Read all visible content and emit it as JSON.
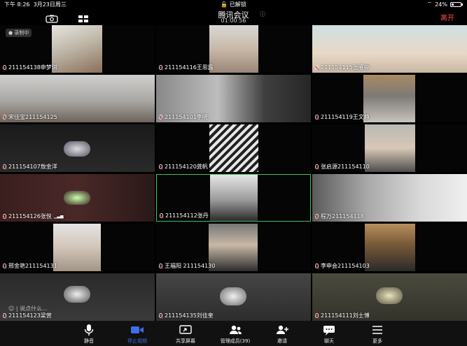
{
  "status": {
    "time": "下午 8:26",
    "date": "3月23日周三",
    "lock": "已解锁",
    "battery": "24%"
  },
  "header": {
    "title": "腾讯会议",
    "timer": "01:00:56",
    "leave": "离开"
  },
  "record_badge": "录制中",
  "chat_hint": "说点什么...",
  "tiles": [
    {
      "name": "211154138申梦琪"
    },
    {
      "name": "211154116王思露"
    },
    {
      "name": "211154115张雁婷"
    },
    {
      "name": "宋佳宝211154125"
    },
    {
      "name": "211154101李晓"
    },
    {
      "name": "211154119王文静"
    },
    {
      "name": "211154107敖金洋"
    },
    {
      "name": "211154120龚帆"
    },
    {
      "name": "张启源211154110"
    },
    {
      "name": "211154126张悦"
    },
    {
      "name": "211154112张丹"
    },
    {
      "name": "程万211154118"
    },
    {
      "name": "邢金艳211154131"
    },
    {
      "name": "王福阳 211154130"
    },
    {
      "name": "李申会211154103"
    },
    {
      "name": "211154123梁营"
    },
    {
      "name": "211154135刘佳奎"
    },
    {
      "name": "211154111刘士博"
    }
  ],
  "toolbar": {
    "mute": "静音",
    "stop_video": "停止视频",
    "share": "共享屏幕",
    "members": "管理成员(39)",
    "invite": "邀请",
    "chat": "聊天",
    "more": "更多"
  },
  "colors": {
    "accent": "#3f6fe8",
    "leave": "#ff4d4f",
    "active_border": "#3ac46b"
  }
}
